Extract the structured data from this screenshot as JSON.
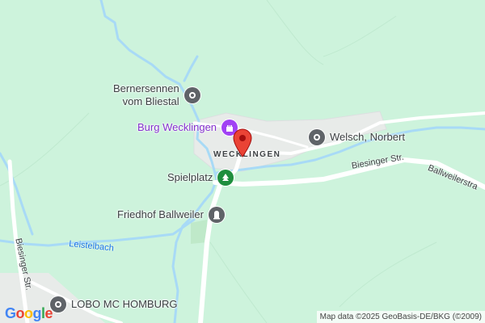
{
  "map": {
    "labels": {
      "bernersennen": [
        "Bernersennen",
        "vom Bliestal"
      ],
      "burg": "Burg Wecklingen",
      "town": "WECKLINGEN",
      "welsch": "Welsch, Norbert",
      "spielplatz": "Spielplatz",
      "friedhof": "Friedhof Ballweiler",
      "lobo": "LOBO MC HOMBURG",
      "biesinger_east": "Biesinger Str.",
      "ballweiler": "Ballweilerstra",
      "leistelbach": "Leistelbach",
      "biesinger_west": "Biesinger Str."
    },
    "icons": {
      "bernersennen": "location-pin-icon",
      "burg": "castle-icon",
      "welsch": "location-pin-icon",
      "spielplatz": "tree-icon",
      "friedhof": "cemetery-icon",
      "lobo": "location-pin-icon",
      "marker": "red-map-marker-icon"
    },
    "colors": {
      "background": "#cdf3dc",
      "water": "#a8daf6",
      "road": "#ffffff",
      "settlement": "#e8ebe9",
      "poi_gray": "#5f6368",
      "poi_green": "#1e8e3e",
      "poi_purple": "#a142f4",
      "marker": "#ea4335"
    }
  },
  "logo": "Google",
  "attribution": "Map data ©2025 GeoBasis-DE/BKG (©2009)"
}
